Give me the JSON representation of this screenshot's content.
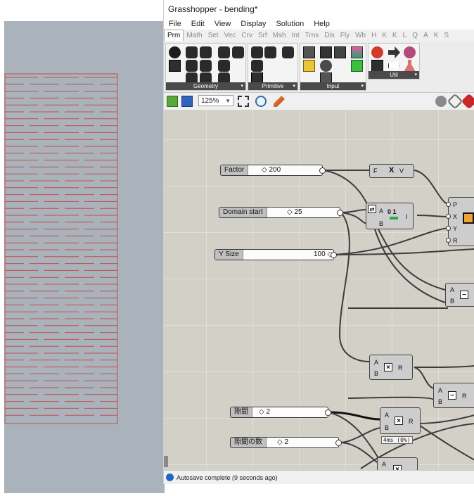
{
  "window": {
    "title": "Grasshopper - bending*"
  },
  "menu": [
    "File",
    "Edit",
    "View",
    "Display",
    "Solution",
    "Help"
  ],
  "tabs": [
    "Prm",
    "Math",
    "Set",
    "Vec",
    "Crv",
    "Srf",
    "Msh",
    "Int",
    "Trns",
    "Dis",
    "Fly",
    "Wb",
    "H",
    "K",
    "K",
    "L",
    "Q",
    "A",
    "K",
    "S"
  ],
  "active_tab": "Prm",
  "ribbon": {
    "panels": [
      {
        "label": "Geometry"
      },
      {
        "label": "Primitive"
      },
      {
        "label": "Input"
      },
      {
        "label": "Util"
      }
    ],
    "expander_glyph": "▾"
  },
  "toolbar": {
    "zoom": "125%"
  },
  "canvas": {
    "sliders": [
      {
        "label": "Factor",
        "value": "◇ 200"
      },
      {
        "label": "Domain start",
        "value": "◇ 25"
      },
      {
        "label": "Y Size",
        "value": "100 ◇"
      },
      {
        "label": "隙間",
        "value": "◇ 2"
      },
      {
        "label": "隙間の数",
        "value": "◇ 2"
      }
    ],
    "components": {
      "expression": {
        "in": "F",
        "glyph": "X",
        "out": "V"
      },
      "remap": {
        "in": [
          "A",
          "B"
        ],
        "glyph": "0 1",
        "out": "I"
      },
      "point": {
        "in": [
          "P",
          "X",
          "Y",
          "R"
        ]
      },
      "subtract_1": {
        "in": [
          "A",
          "B"
        ],
        "op": "−"
      },
      "multiply_1": {
        "in": [
          "A",
          "B"
        ],
        "op": "×",
        "out": "R"
      },
      "subtract_2": {
        "in": [
          "A",
          "B"
        ],
        "op": "−",
        "out": "R"
      },
      "multiply_2": {
        "in": [
          "A",
          "B"
        ],
        "op": "×",
        "out": "R"
      },
      "bottom_comp": {
        "in": [
          "A"
        ],
        "op": "×"
      }
    },
    "meta_tag": "4ms (0%)"
  },
  "status": {
    "text": "Autosave complete (9 seconds ago)"
  },
  "colors": {
    "viewport_bg": "#aab3bb",
    "curve_red": "#c0504d",
    "canvas_bg": "#d3d0c8",
    "wire": "#3c3c3c",
    "status_icon": "#1f66c9"
  }
}
